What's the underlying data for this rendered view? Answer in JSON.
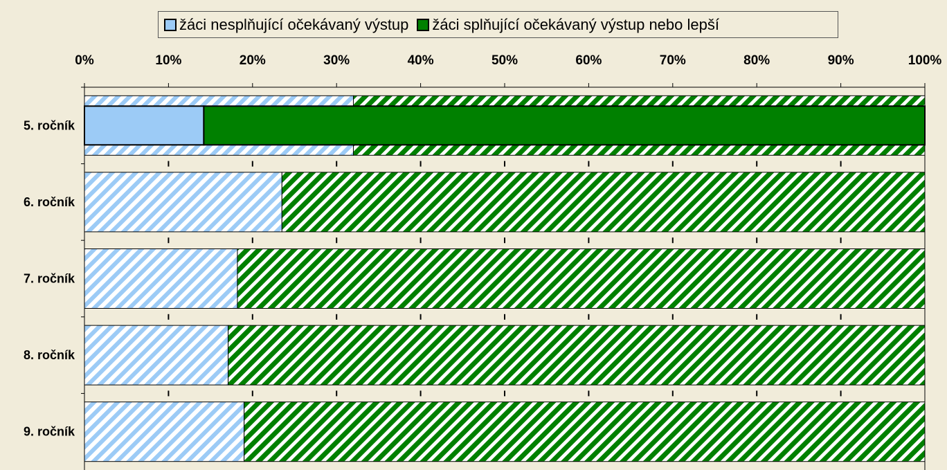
{
  "chart_data": {
    "type": "bar",
    "orientation": "horizontal",
    "stacked": true,
    "normalized_percent": true,
    "categories": [
      "5. ročník",
      "6. ročník",
      "7. ročník",
      "8. ročník",
      "9. ročník"
    ],
    "series": [
      {
        "name": "žáci nesplňující očekávaný výstup",
        "values": [
          32.0,
          23.5,
          18.2,
          17.1,
          19.0
        ],
        "color": "#9CCBF6"
      },
      {
        "name": "žáci splňující očekávaný výstup nebo lepší",
        "values": [
          68.0,
          76.5,
          81.8,
          82.9,
          81.0
        ],
        "color": "#008000"
      }
    ],
    "highlight": {
      "category": "5. ročník",
      "values": [
        14.2,
        85.8
      ]
    },
    "x_ticks": [
      "0%",
      "10%",
      "20%",
      "30%",
      "40%",
      "50%",
      "60%",
      "70%",
      "80%",
      "90%",
      "100%"
    ],
    "xlim": [
      0,
      100
    ],
    "legend_position": "top",
    "pattern": "diagonal-hatch"
  },
  "colors": {
    "background": "#F1ECDA",
    "not_meeting": "#9CCBF6",
    "meeting": "#008000"
  }
}
